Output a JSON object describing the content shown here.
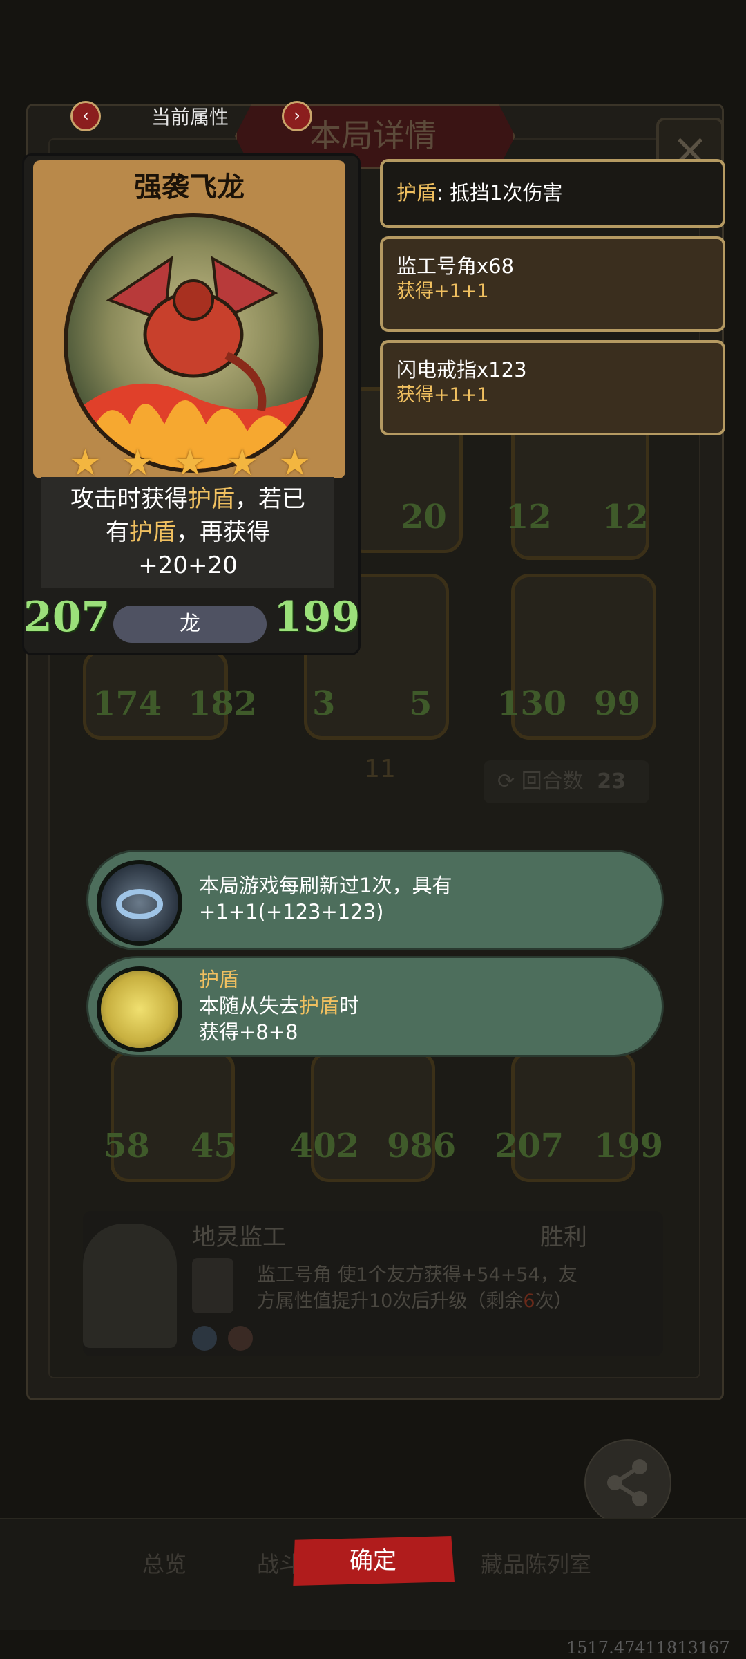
{
  "header": {
    "title": "本局详情",
    "close": "×"
  },
  "nav": {
    "prev": "‹",
    "next": "›",
    "title": "当前属性"
  },
  "card": {
    "name": "强袭飞龙",
    "stars": 5,
    "desc_line1_a": "攻击时获得",
    "desc_line1_hl": "护盾",
    "desc_line1_b": "，若已",
    "desc_line2_a": "有",
    "desc_line2_hl": "护盾",
    "desc_line2_b": "，再获得",
    "desc_line3": "+20+20",
    "attack": "207",
    "health": "199",
    "type": "龙"
  },
  "info_boxes": [
    {
      "title_hl": "护盾",
      "title": ": 抵挡1次伤害",
      "sub": ""
    },
    {
      "title": "监工号角x68",
      "sub": "获得+1+1"
    },
    {
      "title": "闪电戒指x123",
      "sub": "获得+1+1"
    }
  ],
  "bubbles": [
    {
      "icon": "ring-icon",
      "line1": "本局游戏每刷新过1次，具有",
      "line2": "+1+1(+123+123)"
    },
    {
      "icon": "shield-moon-icon",
      "line1_hl": "护盾",
      "line2_a": "本随从失去",
      "line2_hl": "护盾",
      "line2_b": "时",
      "line3": "获得+8+8"
    }
  ],
  "board": {
    "row1": [
      {
        "a": "",
        "h": "20"
      },
      {
        "a": "12",
        "h": "12"
      }
    ],
    "row2": [
      {
        "a": "174",
        "h": "182"
      },
      {
        "a": "3",
        "h": "5"
      },
      {
        "a": "130",
        "h": "99"
      }
    ],
    "step": "11",
    "round_label": "回合数",
    "round_value": "23",
    "row4": [
      {
        "a": "58",
        "h": "45"
      },
      {
        "a": "402",
        "h": "986"
      },
      {
        "a": "207",
        "h": "199"
      }
    ]
  },
  "summary": {
    "name": "地灵监工",
    "result": "胜利",
    "desc_a": "监工号角 使1个友方获得+54+54，友",
    "desc_b": "方属性值提升10次后升级（剩余",
    "desc_remaining": "6",
    "desc_c": "次）"
  },
  "bottom": {
    "tabs": [
      "总览",
      "战斗",
      "藏品陈列室"
    ],
    "confirm": "确定",
    "share": "分享",
    "coord": "1517.47411813167"
  }
}
